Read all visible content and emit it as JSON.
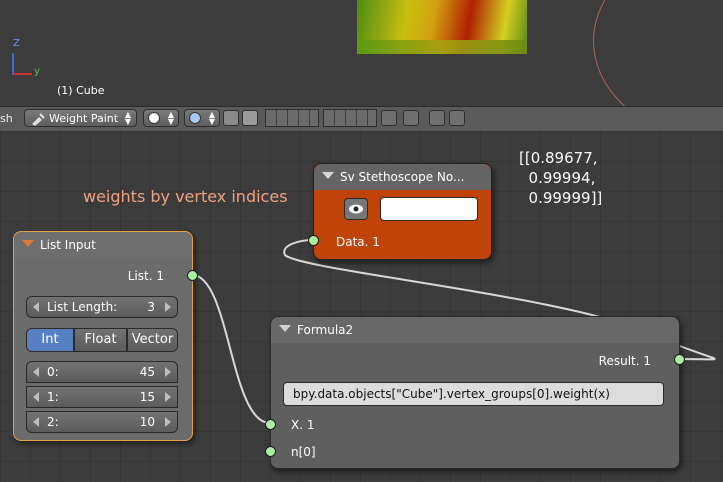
{
  "viewport": {
    "axis_labels": {
      "z": "Z",
      "y": "y"
    },
    "object_label": "(1) Cube"
  },
  "header": {
    "left_text": "sh",
    "mode_label": "Weight Paint"
  },
  "annotation": "weights by vertex indices",
  "stethoscope_output": "[[0.89677,\n  0.99994,\n  0.99999]]",
  "nodes": {
    "stethoscope": {
      "title": "Sv Stethoscope No...",
      "input": "Data. 1",
      "color": "#c0430a"
    },
    "list_input": {
      "title": "List Input",
      "output": "List. 1",
      "list_length_label": "List Length:",
      "list_length_value": "3",
      "tabs": [
        "Int",
        "Float",
        "Vector"
      ],
      "active_tab": "Int",
      "items": [
        {
          "label": "0:",
          "value": "45"
        },
        {
          "label": "1:",
          "value": "15"
        },
        {
          "label": "2:",
          "value": "10"
        }
      ]
    },
    "formula": {
      "title": "Formula2",
      "output": "Result. 1",
      "expression": "bpy.data.objects[\"Cube\"].vertex_groups[0].weight(x)",
      "inputs": [
        "X. 1",
        "n[0]"
      ]
    }
  },
  "colors": {
    "socket": "#a8f0a0",
    "accent_select": "#e6a24a",
    "active_tab": "#5680c2"
  }
}
